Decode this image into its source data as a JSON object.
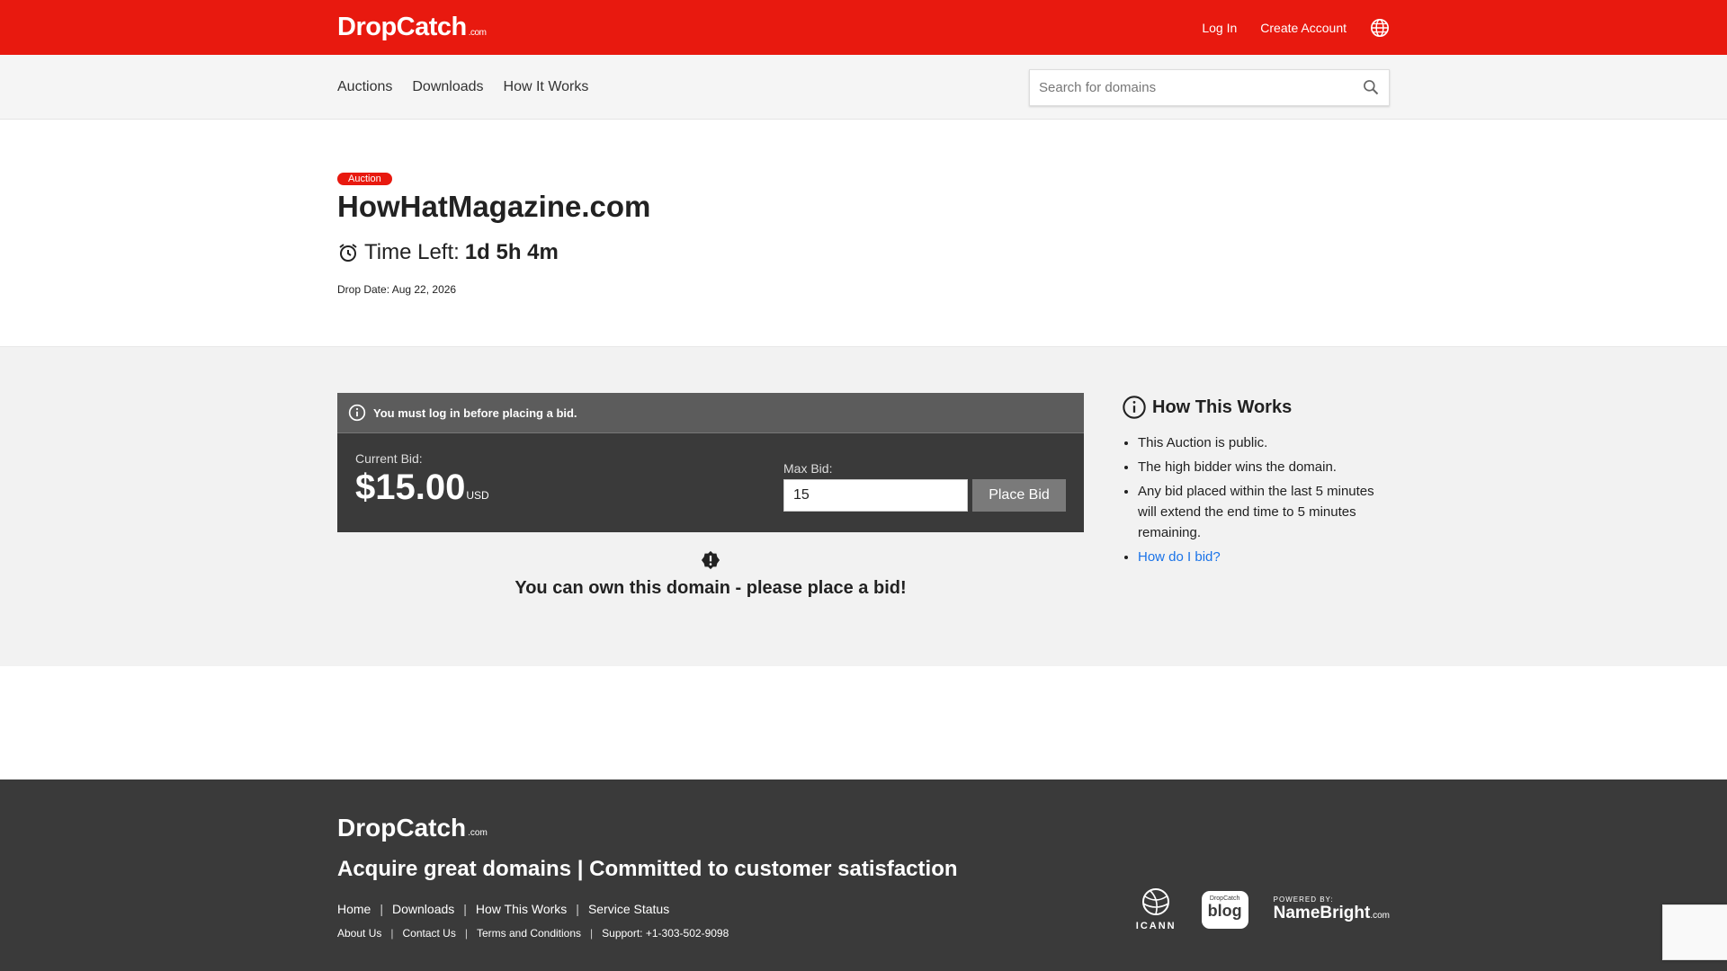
{
  "header": {
    "logo_text": "DropCatch",
    "logo_suffix": ".com",
    "login": "Log In",
    "create_account": "Create Account",
    "language_icon": "globe-icon"
  },
  "nav": {
    "items": [
      "Auctions",
      "Downloads",
      "How It Works"
    ],
    "search_placeholder": "Search for domains",
    "search_icon": "search-icon"
  },
  "listing": {
    "badge": "Auction",
    "domain": "HowHatMagazine.com",
    "time_left_label": "Time Left:",
    "time_left_value": "1d 5h 4m",
    "drop_date": "Drop Date: Aug 22, 2026"
  },
  "bid": {
    "notice": "You must log in before placing a bid.",
    "current_bid_label": "Current Bid:",
    "current_bid_value": "$15.00",
    "currency": "USD",
    "max_bid_label": "Max Bid:",
    "max_bid_value": "15",
    "place_bid_label": "Place Bid",
    "own_message": "You can own this domain - please place a bid!"
  },
  "how_it_works": {
    "title": "How This Works",
    "items": [
      "This Auction is public.",
      "The high bidder wins the domain.",
      "Any bid placed within the last 5 minutes will extend the end time to 5 minutes remaining."
    ],
    "link": "How do I bid?"
  },
  "footer": {
    "logo_text": "DropCatch",
    "logo_suffix": ".com",
    "tagline": "Acquire great domains | Committed to customer satisfaction",
    "links_primary": [
      "Home",
      "Downloads",
      "How This Works",
      "Service Status"
    ],
    "links_secondary": [
      "About Us",
      "Contact Us",
      "Terms and Conditions",
      "Support: +1-303-502-9098"
    ],
    "separator": "|",
    "icann_label": "ICANN",
    "blog_top": "DropCatch",
    "blog_label": "blog",
    "powered_by": "POWERED BY:",
    "namebright": "NameBright",
    "namebright_suffix": ".com"
  },
  "colors": {
    "brand_red": "#e8190f",
    "dark_panel": "#3a3a3a",
    "link_blue": "#1a73e8"
  }
}
